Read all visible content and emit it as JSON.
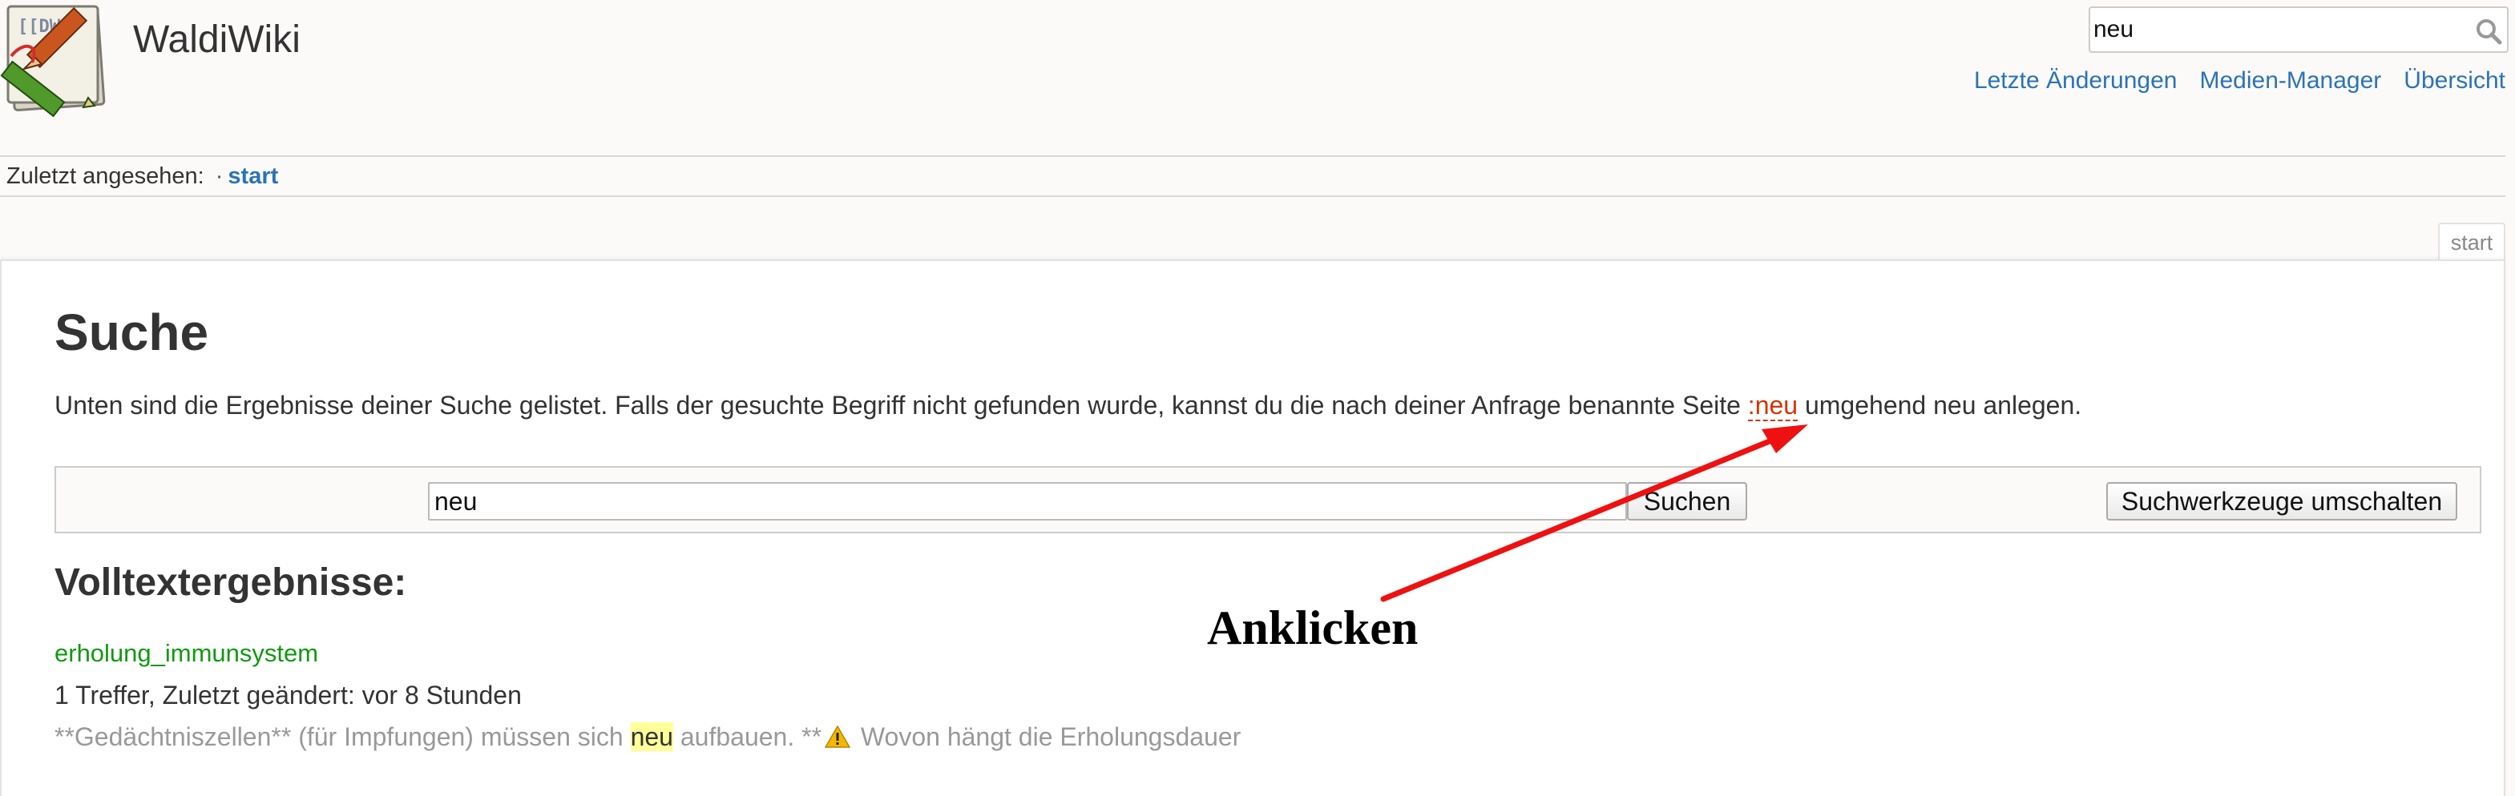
{
  "header": {
    "wiki_title": "WaldiWiki",
    "search_value": "neu",
    "user_tools": [
      {
        "label": "Letzte Änderungen"
      },
      {
        "label": "Medien-Manager"
      },
      {
        "label": "Übersicht"
      }
    ]
  },
  "breadcrumbs": {
    "label": "Zuletzt angesehen:",
    "separator": "·",
    "items": [
      {
        "label": "start"
      }
    ]
  },
  "page_tab": "start",
  "content": {
    "heading": "Suche",
    "intro_before": "Unten sind die Ergebnisse deiner Suche gelistet. Falls der gesuchte Begriff nicht gefunden wurde, kannst du die nach deiner Anfrage benannte Seite ",
    "intro_link": ":neu",
    "intro_after": " umgehend neu anlegen.",
    "search_form": {
      "query": "neu",
      "search_button": "Suchen",
      "toggle_button": "Suchwerkzeuge umschalten"
    },
    "results_heading": "Volltextergebnisse:",
    "results": [
      {
        "title": "erholung_immunsystem",
        "meta": "1 Treffer, Zuletzt geändert: vor 8 Stunden",
        "snippet_before": "**Gedächtniszellen** (für Impfungen) müssen sich ",
        "snippet_highlight": "neu",
        "snippet_middle": " aufbauen. **",
        "snippet_after": " Wovon hängt die Erholungsdauer"
      }
    ]
  },
  "annotation": {
    "text": "Anklicken",
    "color": "#ee1111"
  },
  "colors": {
    "link": "#2b73b7",
    "missing_link": "#d33500",
    "result_link": "#119911",
    "highlight": "#ffff99"
  }
}
